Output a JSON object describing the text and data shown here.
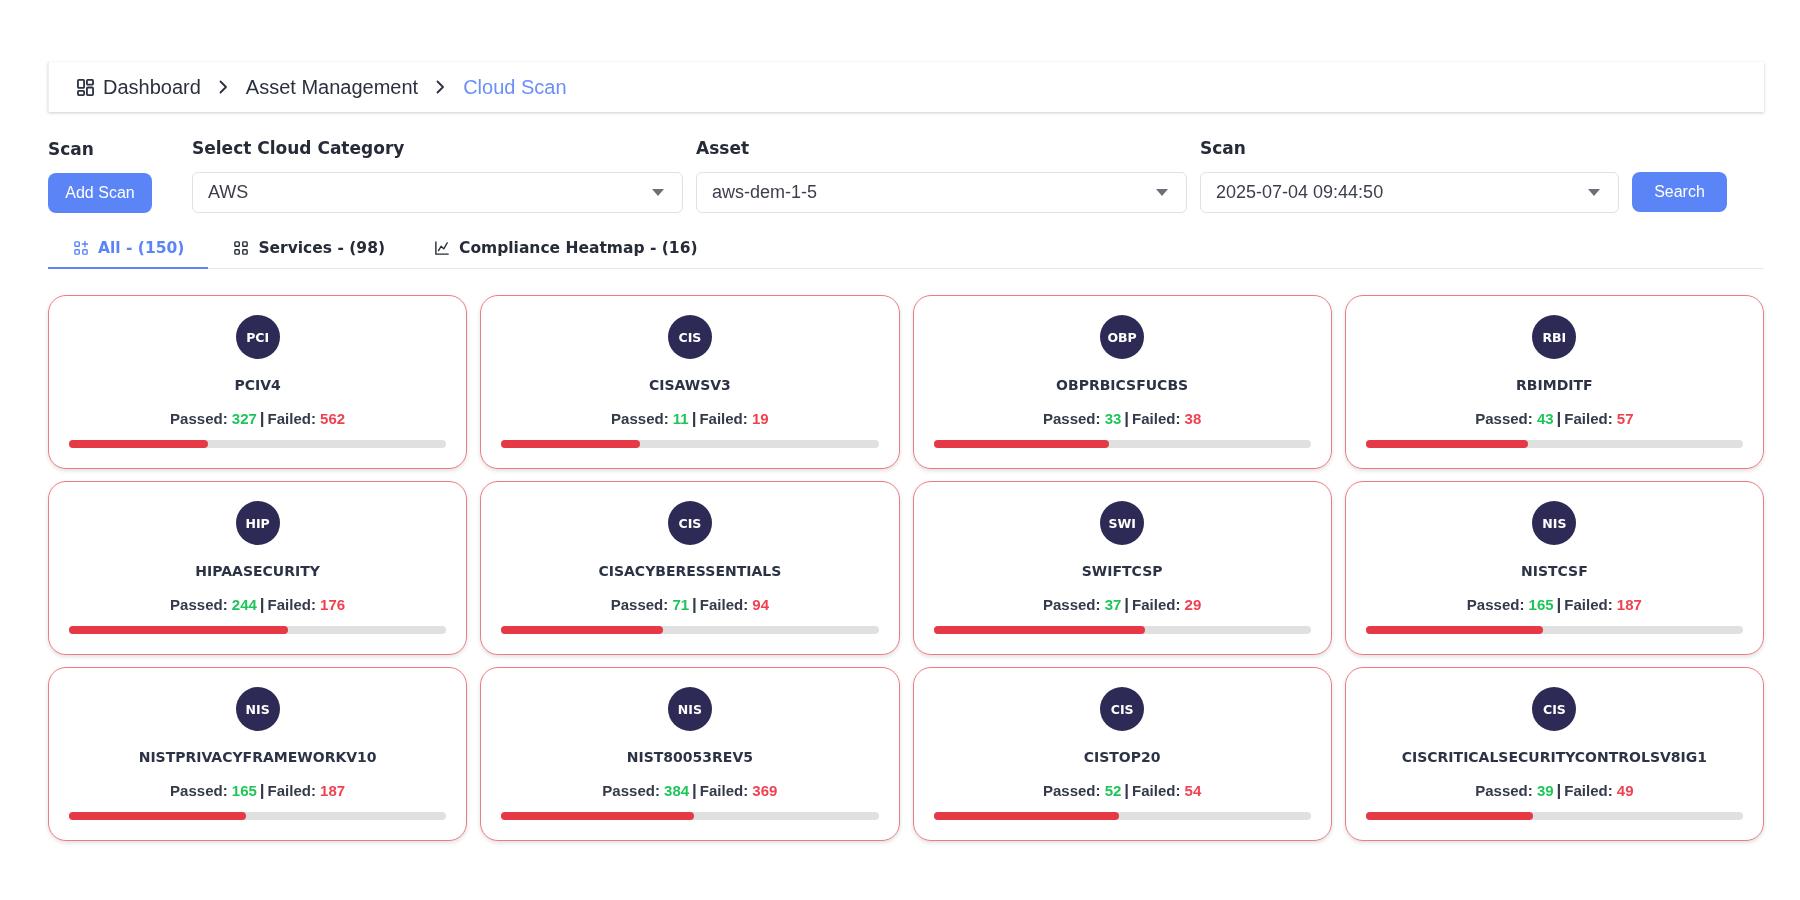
{
  "breadcrumb": [
    {
      "kind": "dashboard",
      "label": "Dashboard",
      "selected": false
    },
    {
      "kind": "link",
      "label": "Asset Management",
      "selected": false
    },
    {
      "kind": "link",
      "label": "Cloud Scan",
      "selected": true
    }
  ],
  "scan_action": {
    "label": "Scan",
    "button": "Add Scan"
  },
  "filters": [
    {
      "label": "Select Cloud Category",
      "value": "AWS"
    },
    {
      "label": "Asset",
      "value": "aws-dem-1-5"
    },
    {
      "label": "Scan",
      "value": "2025-07-04 09:44:50"
    }
  ],
  "search_button": "Search",
  "tabs": [
    {
      "kind": "all",
      "label": "All - (150)",
      "selected": true
    },
    {
      "kind": "services",
      "label": "Services - (98)",
      "selected": false
    },
    {
      "kind": "heatmap",
      "label": "Compliance Heatmap - (16)",
      "selected": false
    }
  ],
  "cards": [
    {
      "badge": "PCI",
      "name": "PCIV4",
      "passed_label": "Passed:",
      "passed": "327",
      "separator": "|",
      "failed_label": "Failed:",
      "failed": "562",
      "level": 0.368
    },
    {
      "badge": "CIS",
      "name": "CISAWSV3",
      "passed_label": "Passed:",
      "passed": "11",
      "separator": "|",
      "failed_label": "Failed:",
      "failed": "19",
      "level": 0.367
    },
    {
      "badge": "OBP",
      "name": "OBPRBICSFUCBS",
      "passed_label": "Passed:",
      "passed": "33",
      "separator": "|",
      "failed_label": "Failed:",
      "failed": "38",
      "level": 0.465
    },
    {
      "badge": "RBI",
      "name": "RBIMDITF",
      "passed_label": "Passed:",
      "passed": "43",
      "separator": "|",
      "failed_label": "Failed:",
      "failed": "57",
      "level": 0.43
    },
    {
      "badge": "HIP",
      "name": "HIPAASECURITY",
      "passed_label": "Passed:",
      "passed": "244",
      "separator": "|",
      "failed_label": "Failed:",
      "failed": "176",
      "level": 0.581
    },
    {
      "badge": "CIS",
      "name": "CISACYBERESSENTIALS",
      "passed_label": "Passed:",
      "passed": "71",
      "separator": "|",
      "failed_label": "Failed:",
      "failed": "94",
      "level": 0.43
    },
    {
      "badge": "SWI",
      "name": "SWIFTCSP",
      "passed_label": "Passed:",
      "passed": "37",
      "separator": "|",
      "failed_label": "Failed:",
      "failed": "29",
      "level": 0.561
    },
    {
      "badge": "NIS",
      "name": "NISTCSF",
      "passed_label": "Passed:",
      "passed": "165",
      "separator": "|",
      "failed_label": "Failed:",
      "failed": "187",
      "level": 0.469
    },
    {
      "badge": "NIS",
      "name": "NISTPRIVACYFRAMEWORKV10",
      "passed_label": "Passed:",
      "passed": "165",
      "separator": "|",
      "failed_label": "Failed:",
      "failed": "187",
      "level": 0.469
    },
    {
      "badge": "NIS",
      "name": "NIST80053REV5",
      "passed_label": "Passed:",
      "passed": "384",
      "separator": "|",
      "failed_label": "Failed:",
      "failed": "369",
      "level": 0.51
    },
    {
      "badge": "CIS",
      "name": "CISTOP20",
      "passed_label": "Passed:",
      "passed": "52",
      "separator": "|",
      "failed_label": "Failed:",
      "failed": "54",
      "level": 0.491
    },
    {
      "badge": "CIS",
      "name": "CISCRITICALSECURITYCONTROLSV8IG1",
      "passed_label": "Passed:",
      "passed": "39",
      "separator": "|",
      "failed_label": "Failed:",
      "failed": "49",
      "level": 0.443
    }
  ]
}
